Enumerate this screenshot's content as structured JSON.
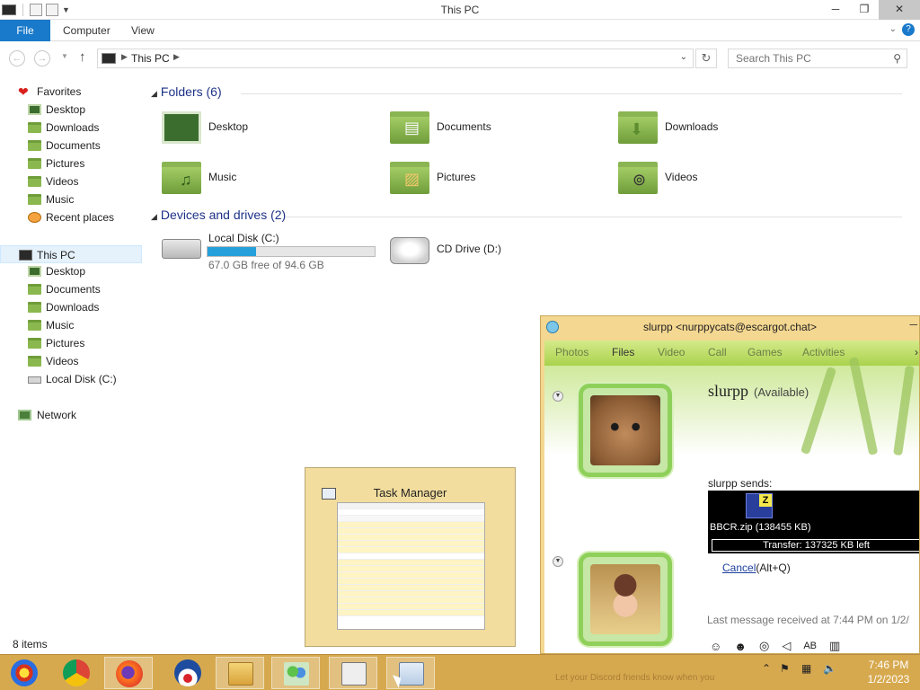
{
  "window": {
    "title": "This PC"
  },
  "ribbon": {
    "tabs": [
      "File",
      "Computer",
      "View"
    ]
  },
  "address": {
    "path": "This PC"
  },
  "search": {
    "placeholder": "Search This PC"
  },
  "nav": {
    "favorites": {
      "label": "Favorites",
      "items": [
        "Desktop",
        "Downloads",
        "Documents",
        "Pictures",
        "Videos",
        "Music",
        "Recent places"
      ]
    },
    "this_pc": {
      "label": "This PC",
      "items": [
        "Desktop",
        "Documents",
        "Downloads",
        "Music",
        "Pictures",
        "Videos",
        "Local Disk (C:)"
      ]
    },
    "network": "Network"
  },
  "content": {
    "folders_header": "Folders (6)",
    "folders": [
      "Desktop",
      "Documents",
      "Downloads",
      "Music",
      "Pictures",
      "Videos"
    ],
    "devices_header": "Devices and drives (2)",
    "drives": [
      {
        "name": "Local Disk (C:)",
        "detail": "67.0 GB free of 94.6 GB",
        "used_fraction": 0.29
      },
      {
        "name": "CD Drive (D:)"
      }
    ]
  },
  "status": {
    "items": "8 items"
  },
  "taskmanager_preview": {
    "title": "Task Manager"
  },
  "messenger": {
    "title": "slurpp <nurppycats@escargot.chat>",
    "tabs": [
      "Photos",
      "Files",
      "Video",
      "Call",
      "Games",
      "Activities"
    ],
    "contact_name": "slurpp",
    "contact_status": "(Available)",
    "sends_label": "slurpp sends:",
    "file_name": "BBCR.zip (138455 KB)",
    "transfer_status": "Transfer: 137325 KB left",
    "cancel_link": "Cancel",
    "cancel_shortcut": "(Alt+Q)",
    "last_message": "Last message received at 7:44 PM on 1/2/",
    "footer_hint": "Let your Discord friends know when you"
  },
  "taskbar": {
    "clock_time": "7:46 PM",
    "clock_date": "1/2/2023"
  },
  "colors": {
    "file_tab": "#1979ca",
    "taskbar": "#d7a94f",
    "drive_fill": "#26a0da",
    "messenger_green": "#8fd05a"
  }
}
